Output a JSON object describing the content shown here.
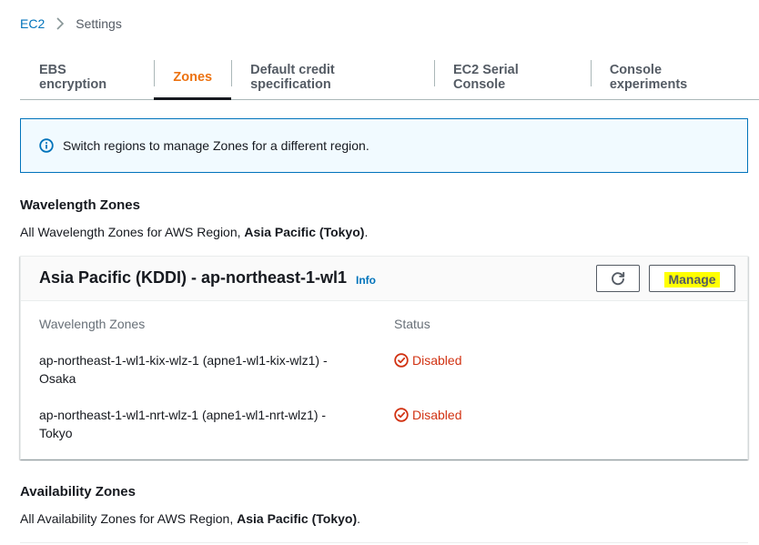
{
  "breadcrumb": {
    "root": "EC2",
    "current": "Settings"
  },
  "tabs": [
    {
      "label": "EBS encryption",
      "active": false
    },
    {
      "label": "Zones",
      "active": true
    },
    {
      "label": "Default credit specification",
      "active": false
    },
    {
      "label": "EC2 Serial Console",
      "active": false
    },
    {
      "label": "Console experiments",
      "active": false
    }
  ],
  "alert": {
    "icon": "info-circle-icon",
    "text": "Switch regions to manage Zones for a different region."
  },
  "wavelength": {
    "title": "Wavelength Zones",
    "desc_prefix": "All Wavelength Zones for AWS Region, ",
    "region": "Asia Pacific (Tokyo)",
    "desc_suffix": ".",
    "card": {
      "title": "Asia Pacific (KDDI) - ap-northeast-1-wl1",
      "info": "Info",
      "manage_label": "Manage",
      "col_zones": "Wavelength Zones",
      "col_status": "Status",
      "rows": [
        {
          "zone": "ap-northeast-1-wl1-kix-wlz-1 (apne1-wl1-kix-wlz1) - Osaka",
          "status": "Disabled"
        },
        {
          "zone": "ap-northeast-1-wl1-nrt-wlz-1 (apne1-wl1-nrt-wlz1) - Tokyo",
          "status": "Disabled"
        }
      ]
    }
  },
  "availability": {
    "title": "Availability Zones",
    "desc_prefix": "All Availability Zones for AWS Region, ",
    "region": "Asia Pacific (Tokyo)",
    "desc_suffix": "."
  },
  "colors": {
    "link": "#0073bb",
    "active_tab": "#ec7211",
    "error": "#d13212",
    "highlight": "#ffff00"
  }
}
